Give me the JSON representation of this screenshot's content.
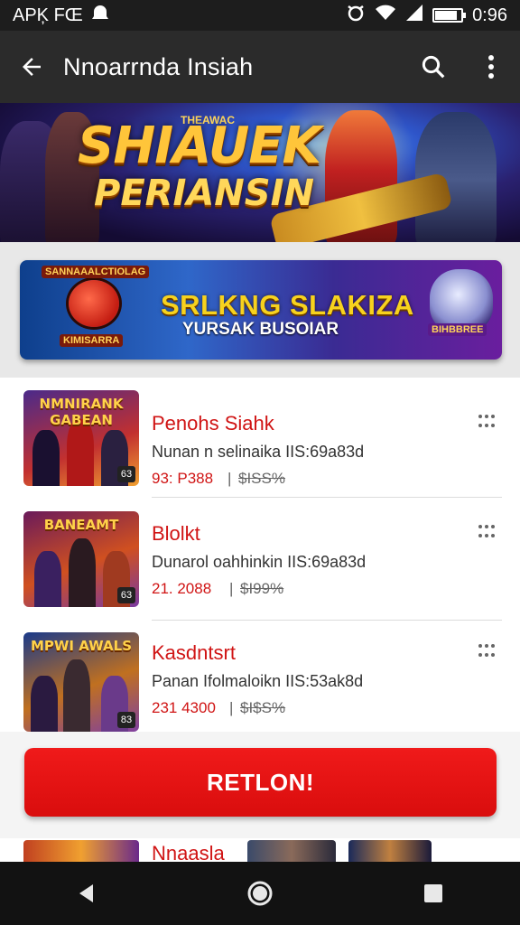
{
  "status_bar": {
    "left_text": "APĶ FŒ",
    "time": "0:96",
    "battery_level": 0.85
  },
  "app_bar": {
    "title": "Nnoarrnda Insiah",
    "back_icon": "arrow-back-icon",
    "search_icon": "search-icon",
    "menu_icon": "more-vert-icon"
  },
  "hero": {
    "small_text": "THEAWAC",
    "line1": "SHIAUEK",
    "line2": "PERIANSIN"
  },
  "promo": {
    "title": "SRLKNG SLAKIZA",
    "subtitle": "YURSAK BUSOIAR",
    "tag_top": "SANNAAALCTIOLAG",
    "tag_bottom": "KIMISARRA",
    "tag_right": "BIHBBREE"
  },
  "items": [
    {
      "thumb_label": "NMNIRANK GABEAN",
      "name": "Penohs Siahk",
      "desc": "Nunan n selinaika IIS:69a83d",
      "price": "93: P388",
      "separator": "|",
      "old_price": "$ISS%",
      "badge": "63",
      "colors": [
        "#2a1a4a",
        "#c23030",
        "#f0a030"
      ]
    },
    {
      "thumb_label": "BANEAMT",
      "name": "Blolkt",
      "desc": "Dunarol oahhinkin IIS:69a83d",
      "price": "21. 2088",
      "separator": "|",
      "old_price": "$I99%",
      "badge": "63",
      "colors": [
        "#4a1a3a",
        "#d05020",
        "#7a3aa0"
      ]
    },
    {
      "thumb_label": "MPWI AWALS",
      "name": "Kasdntsrt",
      "desc": "Panan Ifolmaloikn IIS:53ak8d",
      "price": "231 4300",
      "separator": "|",
      "old_price": "$I$S%",
      "badge": "83",
      "colors": [
        "#1a2a5a",
        "#c07020",
        "#8040a0"
      ]
    }
  ],
  "cta": {
    "label": "RETLON!"
  },
  "peek": {
    "name": "Nnaasla"
  },
  "nav": {
    "back_icon": "nav-back-icon",
    "home_icon": "nav-home-icon",
    "recents_icon": "nav-recents-icon"
  }
}
